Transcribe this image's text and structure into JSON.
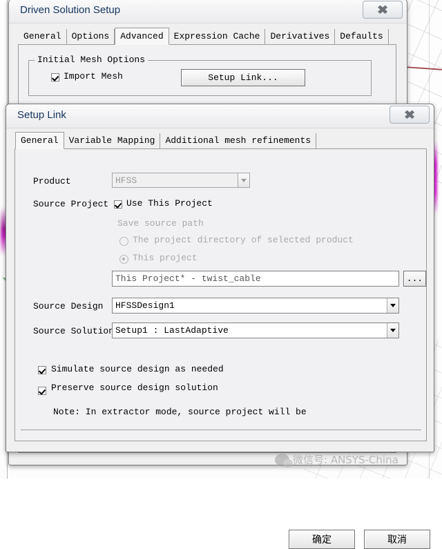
{
  "background": {
    "description": "cad-viewport-behind-dialogs"
  },
  "parent_dialog": {
    "title": "Driven Solution Setup",
    "close_icon": "close-icon",
    "tabs": [
      {
        "label": "General",
        "active": false
      },
      {
        "label": "Options",
        "active": false
      },
      {
        "label": "Advanced",
        "active": true
      },
      {
        "label": "Expression Cache",
        "active": false
      },
      {
        "label": "Derivatives",
        "active": false
      },
      {
        "label": "Defaults",
        "active": false
      }
    ],
    "group": {
      "title": "Initial Mesh Options",
      "import_mesh": {
        "label": "Import Mesh",
        "checked": true
      },
      "setup_link_button": "Setup Link..."
    },
    "footer": {
      "ok_label": "确定",
      "cancel_label": "取消"
    }
  },
  "setup_link_dialog": {
    "title": "Setup Link",
    "close_icon": "close-icon",
    "tabs": [
      {
        "label": "General",
        "active": true
      },
      {
        "label": "Variable Mapping",
        "active": false
      },
      {
        "label": "Additional mesh refinements",
        "active": false
      }
    ],
    "product": {
      "label": "Product",
      "value": "HFSS",
      "enabled": false
    },
    "source_project": {
      "label": "Source Project",
      "use_this_project": {
        "label": "Use This Project",
        "checked": true
      },
      "save_source_path_label": "Save source path",
      "radio_project_directory": {
        "label": "The project directory of selected product",
        "selected": false
      },
      "radio_this_project": {
        "label": "This project",
        "selected": true
      },
      "path_value": "This Project* - twist_cable",
      "browse_button": "..."
    },
    "source_design": {
      "label": "Source Design",
      "value": "HFSSDesign1"
    },
    "source_solution": {
      "label": "Source Solution",
      "value": "Setup1 : LastAdaptive"
    },
    "options": [
      {
        "label": "Simulate source design as needed",
        "checked": true
      },
      {
        "label": "Preserve source design solution",
        "checked": true
      }
    ],
    "note": "Note: In extractor mode, source project will be",
    "footer": {
      "ok_label": "确定",
      "cancel_label": "取消"
    }
  },
  "watermark": {
    "text": "微信号: ANSYS-China",
    "logo_icon": "wechat-icon"
  }
}
